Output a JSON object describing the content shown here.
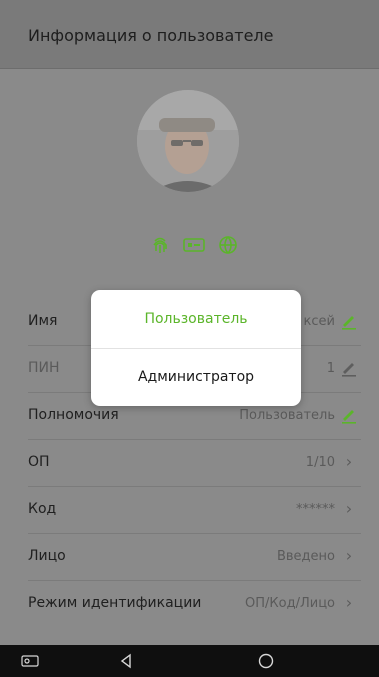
{
  "header": {
    "title": "Информация о пользователе"
  },
  "biometrics": {
    "icons": [
      "fingerprint-icon",
      "card-icon",
      "globe-icon"
    ],
    "accent_color": "#5bb52a"
  },
  "rows": [
    {
      "label": "Имя",
      "value": "ксей",
      "action": "edit-icon"
    },
    {
      "label": "ПИН",
      "value": "1",
      "action": "edit-icon"
    },
    {
      "label": "Полномочия",
      "value": "Пользователь",
      "action": "edit-icon"
    },
    {
      "label": "ОП",
      "value": "1/10",
      "action": "chevron-right-icon"
    },
    {
      "label": "Код",
      "value": "******",
      "action": "chevron-right-icon"
    },
    {
      "label": "Лицо",
      "value": "Введено",
      "action": "chevron-right-icon"
    },
    {
      "label": "Режим идентификации",
      "value": "ОП/Код/Лицо",
      "action": "chevron-right-icon"
    }
  ],
  "dialog": {
    "options": [
      "Пользователь",
      "Администратор"
    ]
  },
  "navbar": {
    "buttons": [
      "screenshot-icon",
      "back-icon",
      "home-icon"
    ]
  }
}
